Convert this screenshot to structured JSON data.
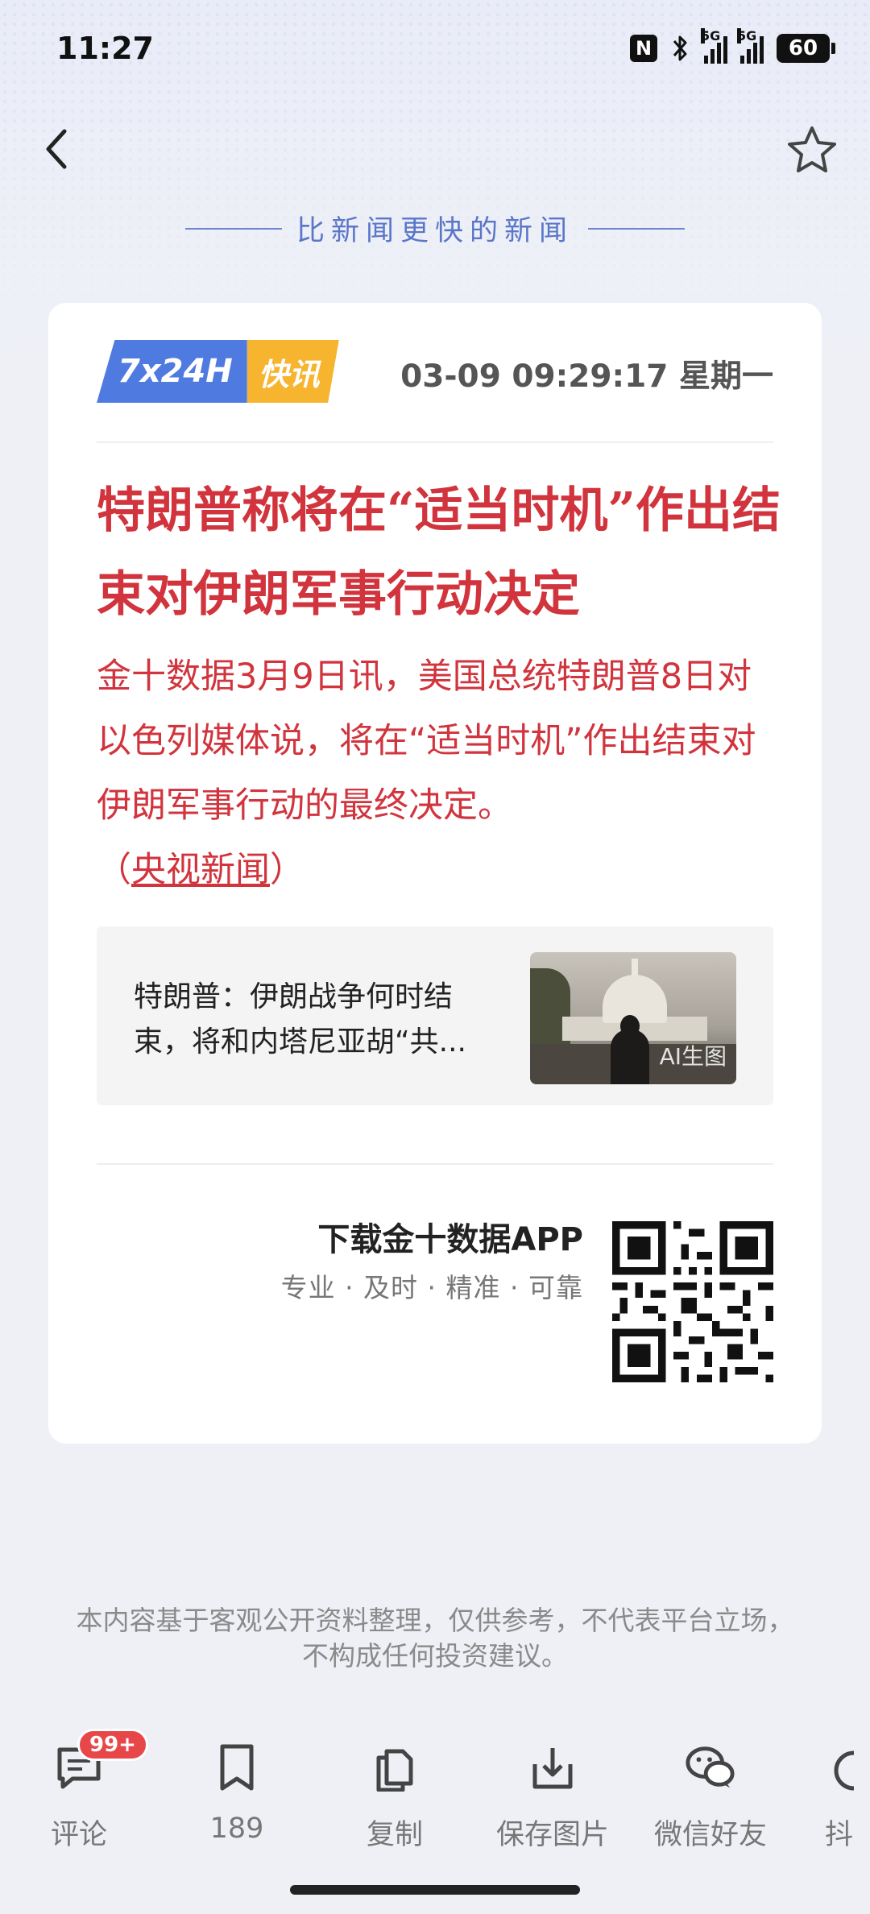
{
  "status_bar": {
    "time": "11:27",
    "nfc_label": "N",
    "network_1": "5G",
    "network_2": "5G",
    "battery": "60"
  },
  "header": {
    "tagline": "比新闻更快的新闻"
  },
  "card": {
    "badge_main": "7x24H",
    "badge_sub": "快讯",
    "datetime": "03-09 09:29:17 星期一",
    "headline": "特朗普称将在“适当时机”作出结束对伊朗军事行动决定",
    "body": "金十数据3月9日讯，美国总统特朗普8日对以色列媒体说，将在“适当时机”作出结束对伊朗军事行动的最终决定。",
    "source_open": "（",
    "source": "央视新闻",
    "source_close": "）",
    "related_title": "特朗普：伊朗战争何时结束，将和内塔尼亚胡“共...",
    "related_thumb_label": "AI生图",
    "download_title": "下载金十数据APP",
    "download_sub": "专业 · 及时 · 精准 · 可靠"
  },
  "disclaimer": "本内容基于客观公开资料整理，仅供参考，不代表平台立场，不构成任何投资建议。",
  "toolbar": {
    "comment_badge": "99+",
    "comment_label": "评论",
    "bookmark_label": "189",
    "copy_label": "复制",
    "save_image_label": "保存图片",
    "wechat_label": "微信好友",
    "douyin_label": "抖"
  },
  "colors": {
    "accent_red": "#d1343d",
    "badge_blue": "#4f7be0",
    "badge_yellow": "#f6b42f",
    "tagline_blue": "#5b76c9"
  }
}
